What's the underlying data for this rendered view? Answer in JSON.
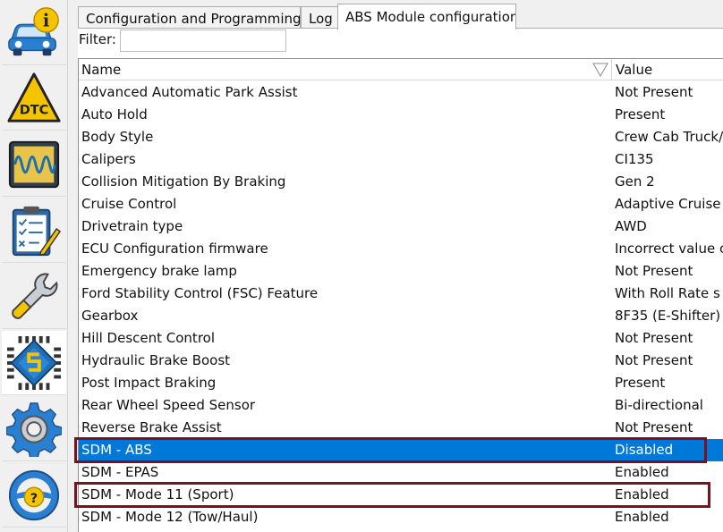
{
  "sidebar": {
    "items": [
      {
        "name": "vehicle-info",
        "icon": "car-info-icon",
        "label": "i"
      },
      {
        "name": "dtc",
        "icon": "dtc-warning-icon",
        "label": "DTC"
      },
      {
        "name": "oscilloscope",
        "icon": "oscilloscope-icon"
      },
      {
        "name": "checklist",
        "icon": "checklist-icon"
      },
      {
        "name": "service",
        "icon": "wrench-icon"
      },
      {
        "name": "module-programming",
        "icon": "chip-icon",
        "active": true
      },
      {
        "name": "settings",
        "icon": "gear-icon"
      },
      {
        "name": "help",
        "icon": "help-wheel-icon",
        "label": "?"
      }
    ]
  },
  "tabs": [
    {
      "label": "Configuration and Programming",
      "active": false
    },
    {
      "label": "Log",
      "active": false
    },
    {
      "label": "ABS Module configuration",
      "active": true
    }
  ],
  "filter": {
    "label": "Filter:",
    "value": "",
    "placeholder": ""
  },
  "grid": {
    "columns": {
      "name": "Name",
      "value": "Value"
    },
    "rows": [
      {
        "name": "Advanced Automatic Park Assist",
        "value": "Not Present"
      },
      {
        "name": "Auto Hold",
        "value": "Present"
      },
      {
        "name": "Body Style",
        "value": "Crew Cab Truck/"
      },
      {
        "name": "Calipers",
        "value": "CI135"
      },
      {
        "name": "Collision Mitigation By Braking",
        "value": "Gen 2"
      },
      {
        "name": "Cruise Control",
        "value": "Adaptive Cruise"
      },
      {
        "name": "Drivetrain type",
        "value": "AWD"
      },
      {
        "name": "ECU Configuration firmware",
        "value": "Incorrect value c"
      },
      {
        "name": "Emergency brake lamp",
        "value": "Not Present"
      },
      {
        "name": "Ford Stability Control (FSC) Feature",
        "value": "With Roll Rate s"
      },
      {
        "name": "Gearbox",
        "value": "8F35 (E-Shifter)"
      },
      {
        "name": "Hill Descent Control",
        "value": "Not Present"
      },
      {
        "name": "Hydraulic Brake Boost",
        "value": "Not Present"
      },
      {
        "name": "Post Impact Braking",
        "value": "Present"
      },
      {
        "name": "Rear Wheel Speed Sensor",
        "value": "Bi-directional"
      },
      {
        "name": "Reverse Brake Assist",
        "value": "Not Present"
      },
      {
        "name": "SDM - ABS",
        "value": "Disabled",
        "selected": true
      },
      {
        "name": "SDM - EPAS",
        "value": "Enabled"
      },
      {
        "name": "SDM - Mode 11 (Sport)",
        "value": "Enabled"
      },
      {
        "name": "SDM - Mode 12 (Tow/Haul)",
        "value": "Enabled"
      }
    ]
  },
  "colors": {
    "selection": "#0078d7",
    "highlight_box": "#7b1020",
    "car_blue": "#2a7fd0",
    "info_yellow": "#f5c400"
  }
}
